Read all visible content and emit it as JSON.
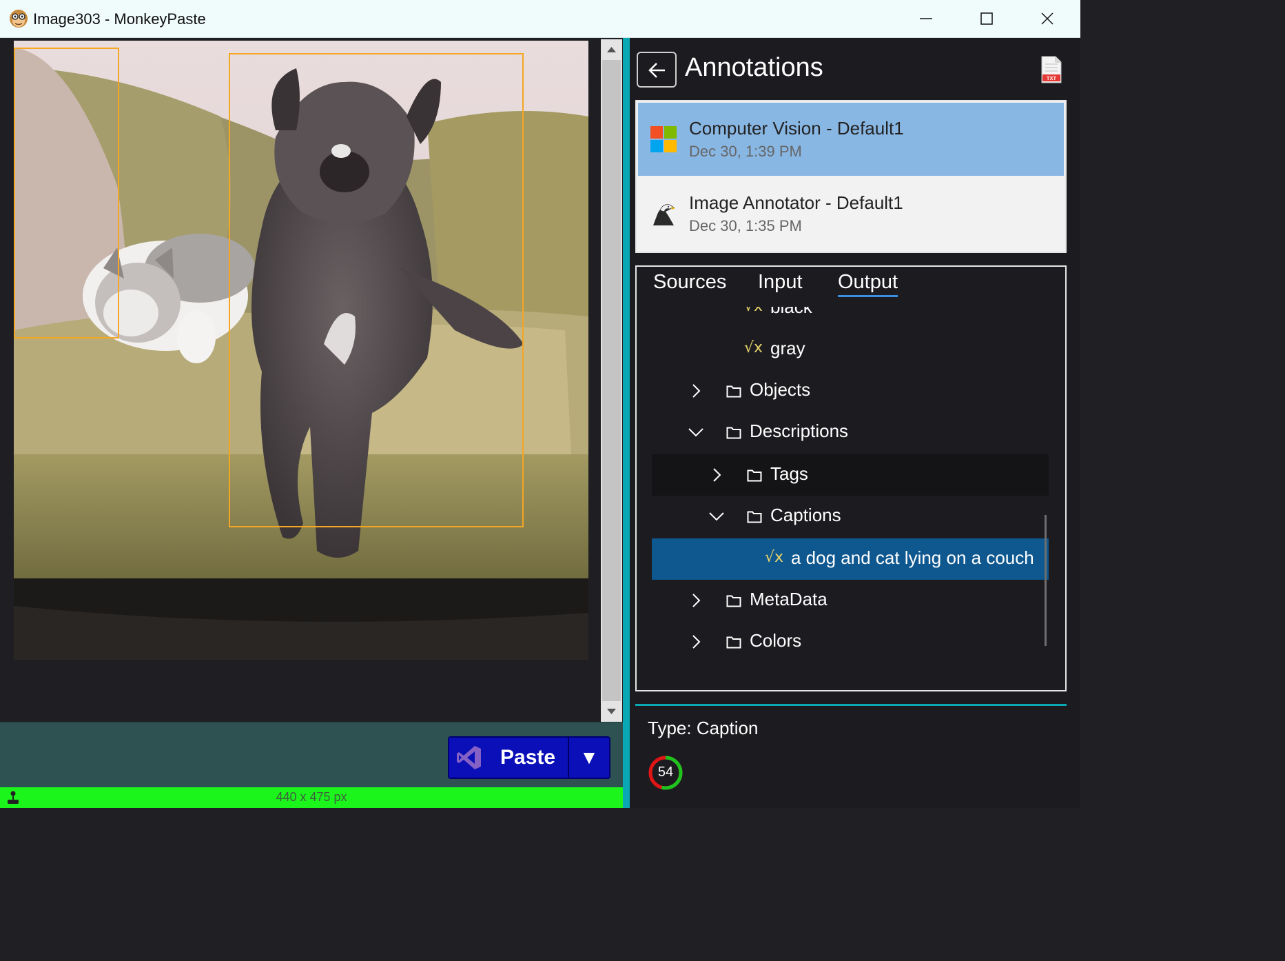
{
  "window": {
    "title": "Image303 - MonkeyPaste",
    "app_icon": "monkey-icon",
    "controls": [
      "minimize-icon",
      "maximize-icon",
      "close-icon"
    ]
  },
  "left": {
    "bounding_box_count": 2,
    "paste_button": {
      "label": "Paste",
      "icon": "visual-studio-icon",
      "dropdown": "▼"
    },
    "status": {
      "dimensions": "440 x 475 px",
      "icon": "joystick-icon"
    },
    "colors": {
      "status_bar": "#1cf51c",
      "bottom_bar": "#2e5252",
      "bbox": "#f5a623",
      "paste_button": "#0b0fb8"
    }
  },
  "annotations": {
    "title": "Annotations",
    "back_icon": "arrow-left-icon",
    "export_icon": "txt-file-icon",
    "sources": [
      {
        "name": "Computer Vision - Default1",
        "date": "Dec 30, 1:39 PM",
        "icon": "microsoft-logo-icon",
        "selected": true
      },
      {
        "name": "Image Annotator - Default1",
        "date": "Dec 30, 1:35 PM",
        "icon": "eagle-icon",
        "selected": false
      }
    ],
    "tabs": [
      {
        "label": "Sources",
        "active": false
      },
      {
        "label": "Input",
        "active": false
      },
      {
        "label": "Output",
        "active": true
      }
    ],
    "tree": [
      {
        "label": "black",
        "kind": "value",
        "depth": 3
      },
      {
        "label": "gray",
        "kind": "value",
        "depth": 3
      },
      {
        "label": "Objects",
        "kind": "folder",
        "depth": 1,
        "expanded": false
      },
      {
        "label": "Descriptions",
        "kind": "folder",
        "depth": 1,
        "expanded": true
      },
      {
        "label": "Tags",
        "kind": "folder",
        "depth": 2,
        "expanded": false
      },
      {
        "label": "Captions",
        "kind": "folder",
        "depth": 2,
        "expanded": true
      },
      {
        "label": "a dog and cat lying on a couch",
        "kind": "value",
        "depth": 3,
        "selected": true
      },
      {
        "label": "MetaData",
        "kind": "folder",
        "depth": 1,
        "expanded": false
      },
      {
        "label": "Colors",
        "kind": "folder",
        "depth": 1,
        "expanded": false
      }
    ],
    "detail": {
      "type_label": "Type: Caption",
      "score": "54"
    },
    "colors": {
      "accent": "#0aa7b5",
      "selected_row": "#0e578f",
      "selected_source": "#89b7e4",
      "score_green": "#1ec41e",
      "score_red": "#e01515",
      "sqrt": "#e8d36a"
    }
  }
}
